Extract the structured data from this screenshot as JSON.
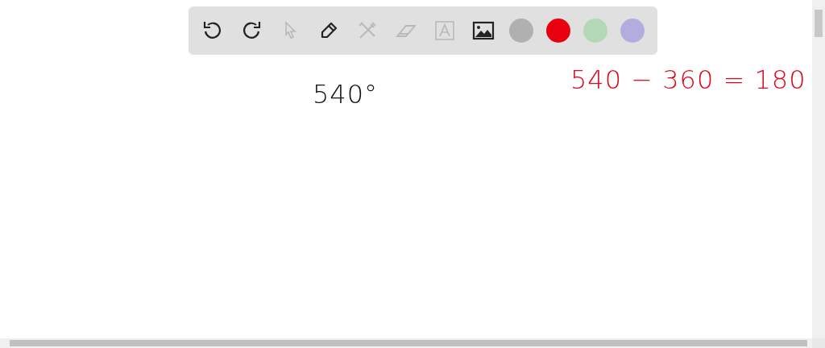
{
  "toolbar": {
    "tools": [
      {
        "kind": "undo",
        "disabled": false
      },
      {
        "kind": "redo",
        "disabled": false
      },
      {
        "kind": "select",
        "disabled": true
      },
      {
        "kind": "pen",
        "disabled": false
      },
      {
        "kind": "shapes",
        "disabled": true
      },
      {
        "kind": "eraser",
        "disabled": true
      },
      {
        "kind": "text",
        "disabled": true
      },
      {
        "kind": "image",
        "disabled": false
      }
    ],
    "colors": [
      {
        "color": "#b0b0b0"
      },
      {
        "color": "#e8000f"
      },
      {
        "color": "#b3d8b5"
      },
      {
        "color": "#b1addf"
      }
    ]
  },
  "canvas": {
    "notes": [
      {
        "text": "540°",
        "color": "#111111"
      },
      {
        "text": "540 − 360 = 180",
        "color": "#dd0a1e"
      }
    ]
  }
}
